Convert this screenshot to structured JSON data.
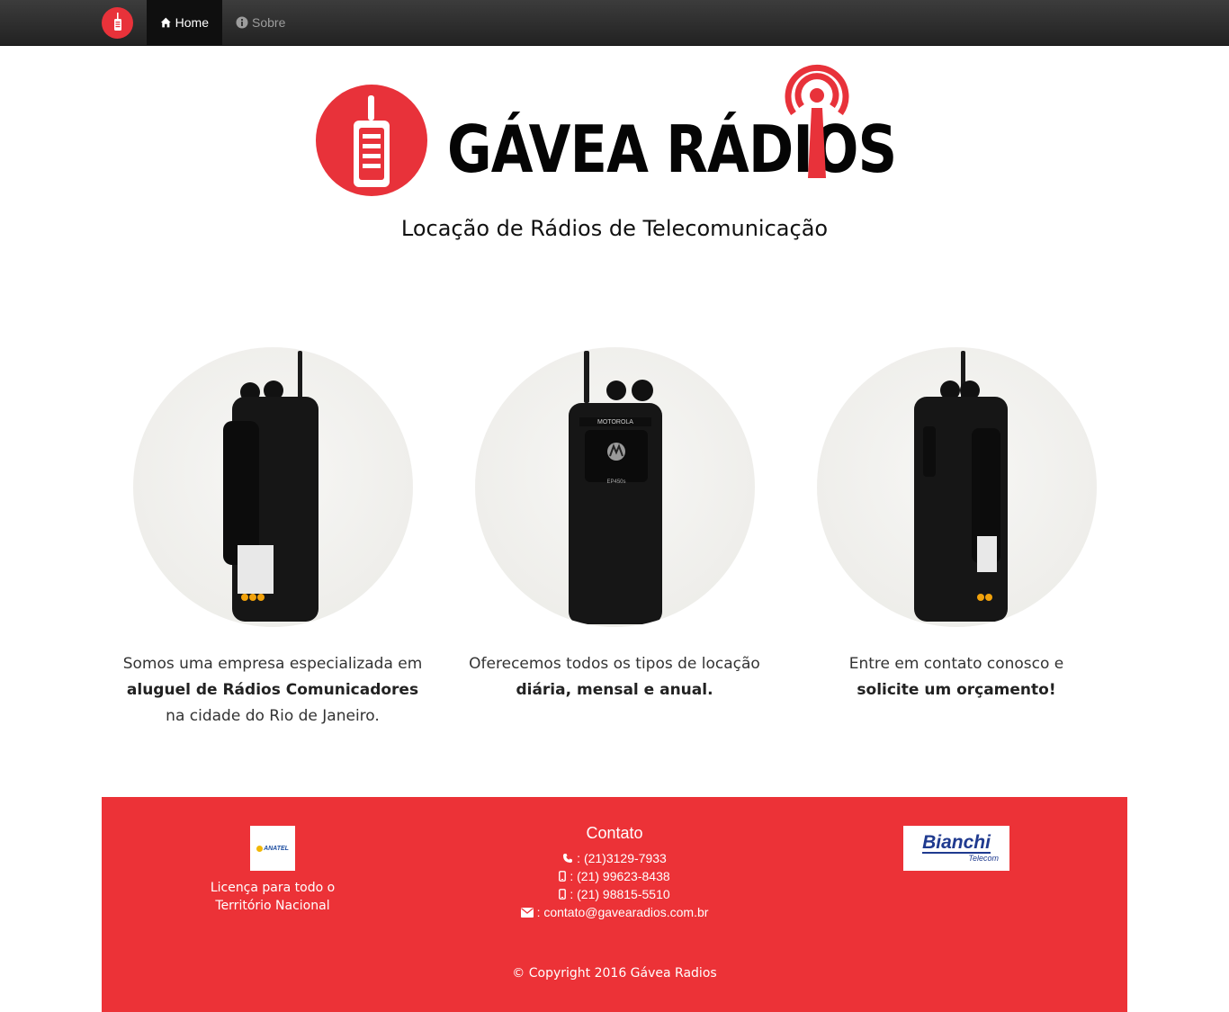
{
  "nav": {
    "brand_icon": "walkie-talkie-icon",
    "items": [
      {
        "label": "Home",
        "icon": "home-icon",
        "active": true
      },
      {
        "label": "Sobre",
        "icon": "info-icon",
        "active": false
      }
    ]
  },
  "header": {
    "logo_text": "GÁVEA RÁDIOS",
    "tagline": "Locação de Rádios de Telecomunicação"
  },
  "features": [
    {
      "line1": "Somos uma empresa especializada em",
      "bold": "aluguel de Rádios Comunicadores",
      "line3": "na cidade do Rio de Janeiro."
    },
    {
      "line1": "Oferecemos todos os tipos de locação",
      "bold": "diária, mensal e anual."
    },
    {
      "line1": "Entre em contato conosco e",
      "bold": "solicite um orçamento!"
    }
  ],
  "footer": {
    "anatel_logo_text": "ANATEL",
    "license_line1": "Licença para todo o",
    "license_line2": "Território Nacional",
    "contact_title": "Contato",
    "contacts": [
      {
        "icon": "phone-icon",
        "text": ": (21)3129-7933"
      },
      {
        "icon": "mobile-icon",
        "text": ": (21) 99623-8438"
      },
      {
        "icon": "mobile-icon",
        "text": ": (21) 98815-5510"
      },
      {
        "icon": "envelope-icon",
        "text": ": contato@gavearadios.com.br"
      }
    ],
    "partner_name": "Bianchi",
    "partner_sub": "Telecom",
    "copyright": "© Copyright 2016 Gávea Radios"
  },
  "colors": {
    "brand_red": "#e8323a",
    "footer_red": "#ec3237",
    "navbar_dark": "#222222"
  }
}
